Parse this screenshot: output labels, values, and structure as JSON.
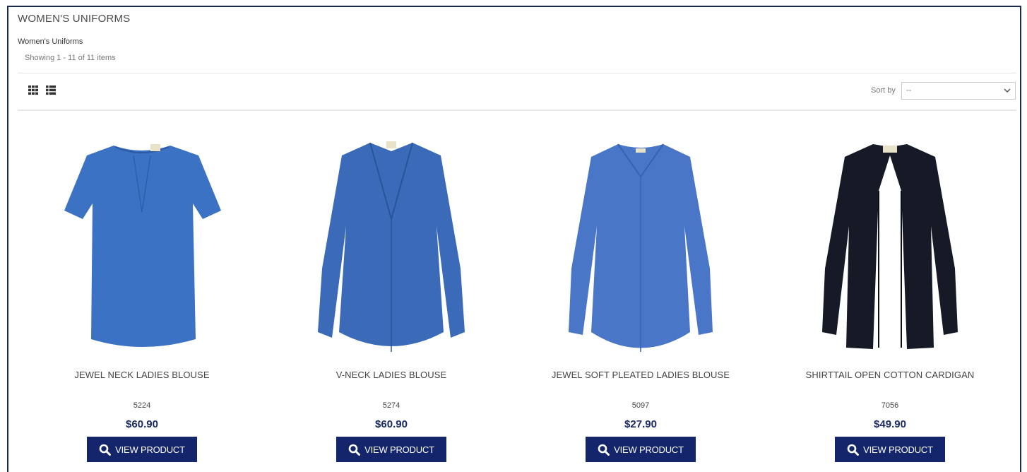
{
  "page": {
    "title": "WOMEN'S UNIFORMS",
    "breadcrumb": "Women's Uniforms",
    "showing": "Showing 1 - 11 of 11 items"
  },
  "toolbar": {
    "view_icons": [
      "grid-view-icon",
      "list-view-icon"
    ],
    "sort_label": "Sort by",
    "sort_value": "--"
  },
  "products": [
    {
      "name": "JEWEL NECK LADIES BLOUSE",
      "sku": "5224",
      "price": "$60.90",
      "button": "VIEW PRODUCT",
      "color": "#3c72c4"
    },
    {
      "name": "V-NECK LADIES BLOUSE",
      "sku": "5274",
      "price": "$60.90",
      "button": "VIEW PRODUCT",
      "color": "#3a6ab8"
    },
    {
      "name": "JEWEL SOFT PLEATED LADIES BLOUSE",
      "sku": "5097",
      "price": "$27.90",
      "button": "VIEW PRODUCT",
      "color": "#4a76c8"
    },
    {
      "name": "SHIRTTAIL OPEN COTTON CARDIGAN",
      "sku": "7056",
      "price": "$49.90",
      "button": "VIEW PRODUCT",
      "color": "#161a26"
    }
  ],
  "colors": {
    "border": "#1d2b4f",
    "button_bg": "#14256b",
    "price": "#1b2a66"
  }
}
